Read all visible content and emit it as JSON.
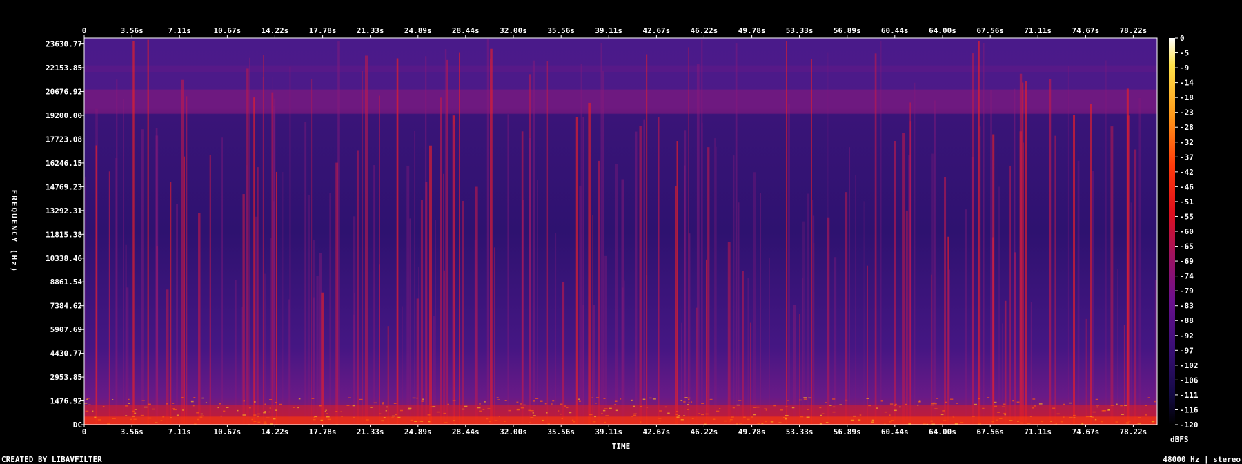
{
  "chart_data": {
    "type": "heatmap",
    "chart_kind": "spectrogram",
    "xlabel": "TIME",
    "ylabel": "FREQUENCY (Hz)",
    "x_ticks": [
      "0",
      "3.56s",
      "7.11s",
      "10.67s",
      "14.22s",
      "17.78s",
      "21.33s",
      "24.89s",
      "28.44s",
      "32.00s",
      "35.56s",
      "39.11s",
      "42.67s",
      "46.22s",
      "49.78s",
      "53.33s",
      "56.89s",
      "60.44s",
      "64.00s",
      "67.56s",
      "71.11s",
      "74.67s",
      "78.22s"
    ],
    "x_tick_values": [
      0,
      3.56,
      7.11,
      10.67,
      14.22,
      17.78,
      21.33,
      24.89,
      28.44,
      32.0,
      35.56,
      39.11,
      42.67,
      46.22,
      49.78,
      53.33,
      56.89,
      60.44,
      64.0,
      67.56,
      71.11,
      74.67,
      78.22
    ],
    "xlim": [
      0,
      80
    ],
    "y_ticks": [
      "DC",
      "1476.92",
      "2953.85",
      "4430.77",
      "5907.69",
      "7384.62",
      "8861.54",
      "10338.46",
      "11815.38",
      "13292.31",
      "14769.23",
      "16246.15",
      "17723.08",
      "19200.00",
      "20676.92",
      "22153.85",
      "23630.77"
    ],
    "y_tick_values": [
      0,
      1476.92,
      2953.85,
      4430.77,
      5907.69,
      7384.62,
      8861.54,
      10338.46,
      11815.38,
      13292.31,
      14769.23,
      16246.15,
      17723.08,
      19200.0,
      20676.92,
      22153.85,
      23630.77
    ],
    "ylim": [
      0,
      24000
    ],
    "colorbar": {
      "unit": "dBFS",
      "range": [
        -120,
        0
      ],
      "ticks": [
        "0",
        "-5",
        "-9",
        "-14",
        "-18",
        "-23",
        "-28",
        "-32",
        "-37",
        "-42",
        "-46",
        "-51",
        "-55",
        "-60",
        "-65",
        "-69",
        "-74",
        "-79",
        "-83",
        "-88",
        "-92",
        "-97",
        "-102",
        "-106",
        "-111",
        "-116",
        "-120"
      ],
      "colors": [
        "#ffffff",
        "#ffe24a",
        "#ff9a1a",
        "#ff3a0a",
        "#e00f1c",
        "#a0125e",
        "#6a0f8e",
        "#3a0e76",
        "#140a45",
        "#000000"
      ]
    },
    "grid": false
  },
  "footer": {
    "credit": "CREATED BY LIBAVFILTER",
    "stream_info": "48000 Hz | stereo"
  }
}
